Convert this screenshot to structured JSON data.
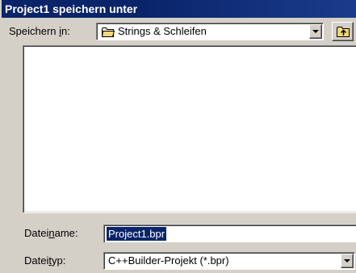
{
  "window": {
    "title": "Project1 speichern unter"
  },
  "location": {
    "label_pre": "Speichern ",
    "label_key": "i",
    "label_post": "n:",
    "value": "Strings & Schleifen"
  },
  "filename": {
    "label_pre": "Datei",
    "label_key": "n",
    "label_post": "ame:",
    "value": "Project1.bpr"
  },
  "filetype": {
    "label_pre": "Datei",
    "label_key": "t",
    "label_post": "yp:",
    "value": "C++Builder-Projekt (*.bpr)"
  },
  "icons": {
    "location_folder": "folder-icon",
    "up_folder": "up-one-level-icon",
    "dropdown": "chevron-down-icon"
  },
  "colors": {
    "titlebar": "#0a246a",
    "selection": "#0a246a",
    "dialog_bg": "#d4d0c8"
  }
}
